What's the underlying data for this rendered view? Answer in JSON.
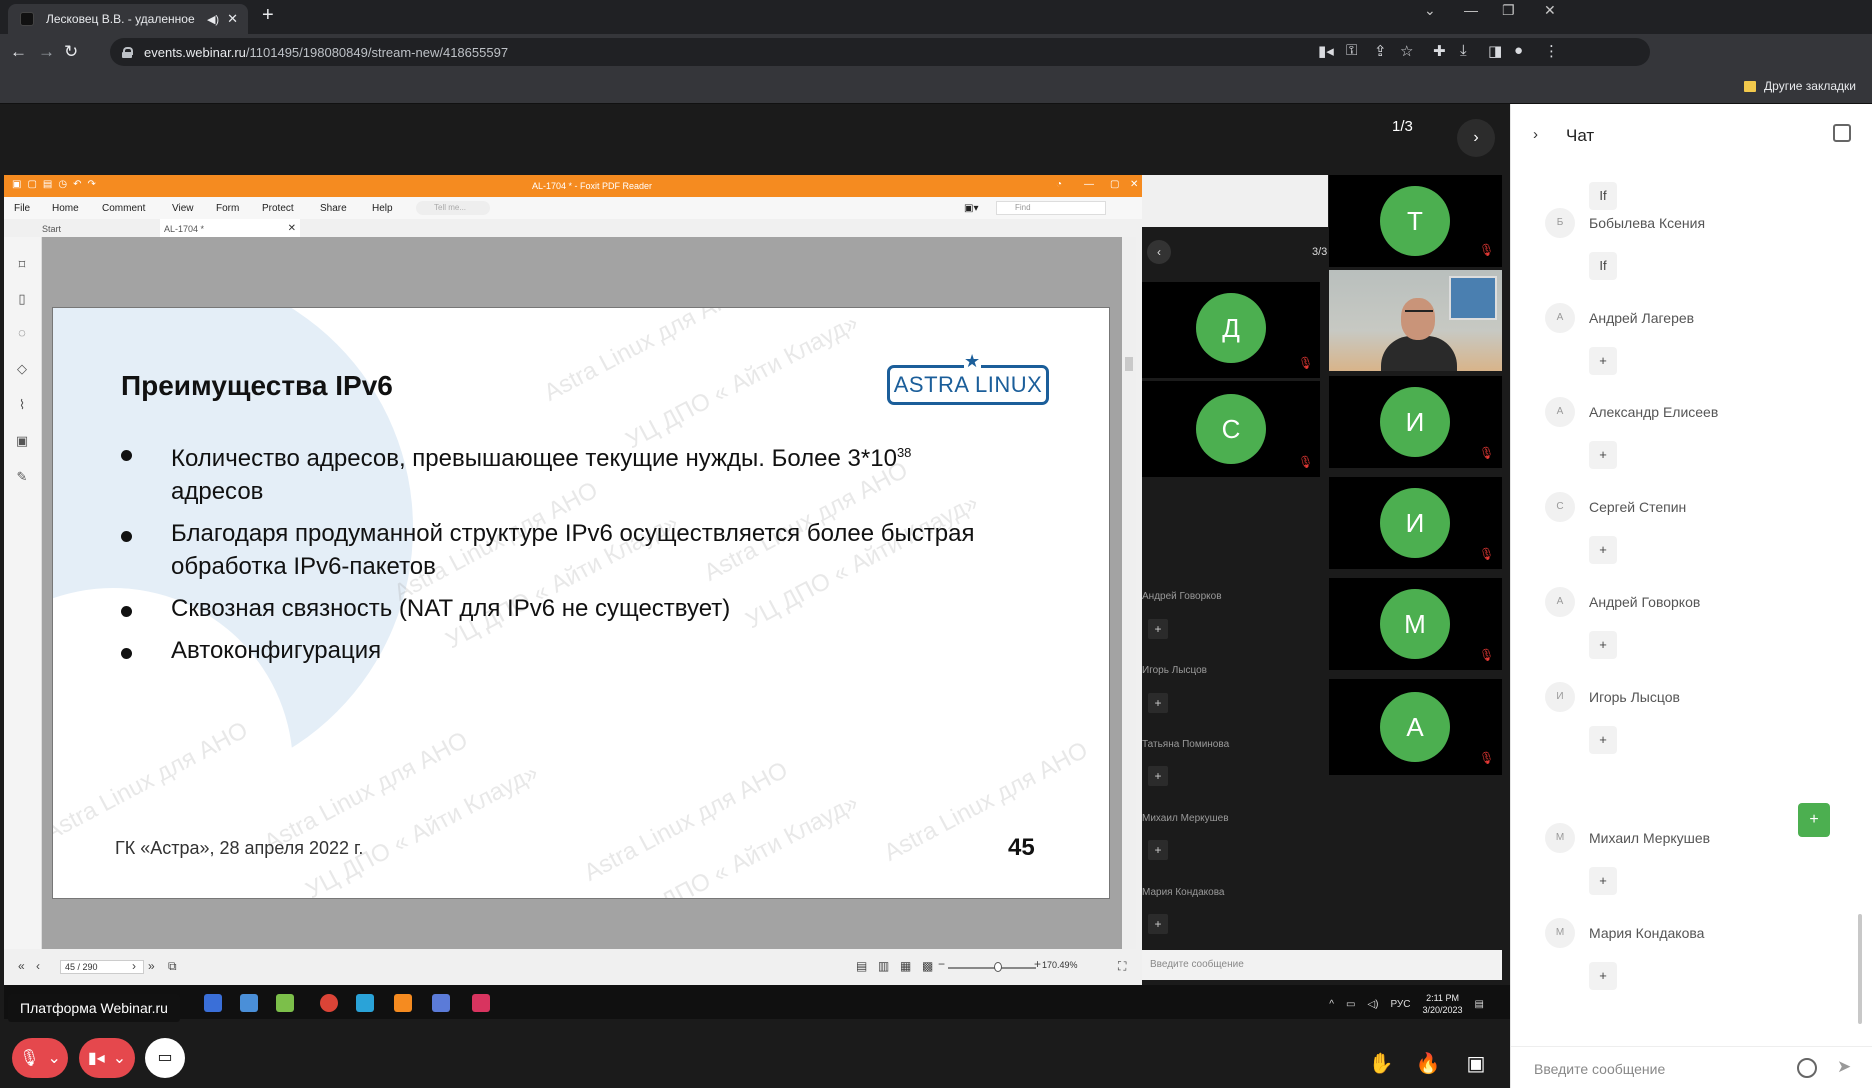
{
  "browser": {
    "tab_title": "Лесковец В.В. - удаленное",
    "new_tab": "+",
    "url_host": "events.webinar.ru",
    "url_path": "/1101495/198080849/stream-new/418655597",
    "other_bookmarks": "Другие закладки"
  },
  "webinar": {
    "pager": "1/3",
    "remote_pager": "3/3",
    "platform_label": "Платформа Webinar.ru"
  },
  "foxit": {
    "window_title": "AL-1704 * - Foxit PDF Reader",
    "menu": [
      "File",
      "Home",
      "Comment",
      "View",
      "Form",
      "Protect",
      "Share",
      "Help"
    ],
    "tell_me": "Tell me...",
    "find": "Find",
    "tab_start": "Start",
    "tab_doc": "AL-1704 *",
    "page_indicator": "45 / 290",
    "zoom": "170.49%"
  },
  "slide": {
    "title": "Преимущества IPv6",
    "logo": "ASTRA LINUX",
    "bullets": [
      "Количество адресов, превышающее текущие нужды. Более 3*10",
      "Благодаря продуманной структуре IPv6 осуществляется более быстрая обработка IPv6-пакетов",
      "Сквозная связность (NAT для IPv6 не существует)",
      "Автоконфигурация"
    ],
    "superscript": "38",
    "bullet1_tail": "адресов",
    "footer": "ГК «Астра», 28 апреля 2022 г.",
    "page_number": "45",
    "watermark_a": "Astra Linux для АНО",
    "watermark_b": "УЦ ДПО « Айти Клауд»"
  },
  "taskbar": {
    "lang": "РУС",
    "time": "2:11 PM",
    "date": "3/20/2023"
  },
  "remote": {
    "tiles": [
      {
        "letter": "Т"
      },
      {
        "letter": "Д"
      },
      {
        "letter": "С"
      },
      {
        "letter": "И"
      },
      {
        "letter": "И"
      },
      {
        "letter": "М"
      },
      {
        "letter": "А"
      }
    ],
    "names": [
      "Андрей Говорков",
      "Игорь Лысцов",
      "Татьяна Поминова",
      "Михаил Меркушев",
      "Мария Кондакова"
    ],
    "plus": "+",
    "message_placeholder": "Введите сообщение"
  },
  "chat": {
    "title": "Чат",
    "messages": [
      {
        "initial": "",
        "name": "",
        "text": "If"
      },
      {
        "initial": "Б",
        "name": "Бобылева Ксения",
        "text": "If"
      },
      {
        "initial": "А",
        "name": "Андрей Лагерев",
        "text": "+"
      },
      {
        "initial": "А",
        "name": "Александр Елисеев",
        "text": "+"
      },
      {
        "initial": "С",
        "name": "Сергей Степин",
        "text": "+"
      },
      {
        "initial": "А",
        "name": "Андрей Говорков",
        "text": "+"
      },
      {
        "initial": "И",
        "name": "Игорь Лысцов",
        "text": "+"
      },
      {
        "initial": "М",
        "name": "Михаил Меркушев",
        "text": "+"
      },
      {
        "initial": "М",
        "name": "Мария Кондакова",
        "text": "+"
      }
    ],
    "green_plus": "+",
    "input_placeholder": "Введите сообщение"
  },
  "colors": {
    "foxit_accent": "#f58b20",
    "avatar_green": "#4caf50",
    "control_red": "#e5484d",
    "astra_blue": "#1b5e9a"
  }
}
